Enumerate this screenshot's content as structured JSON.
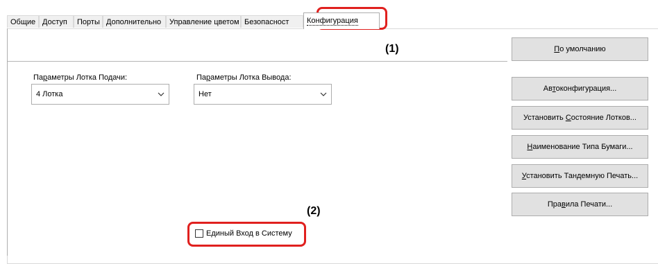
{
  "tabs": [
    {
      "label": "Общие"
    },
    {
      "label": "Доступ"
    },
    {
      "label": "Порты"
    },
    {
      "label": "Дополнительно"
    },
    {
      "label": "Управление цветом"
    },
    {
      "label": "Безопасност"
    },
    {
      "label": "Конфигурация"
    }
  ],
  "active_tab": "Конфигурация",
  "callouts": {
    "one": "(1)",
    "two": "(2)"
  },
  "defaults_button": {
    "pre": "",
    "ul": "П",
    "post": "о умолчанию"
  },
  "input_tray": {
    "label_pre": "Па",
    "label_ul": "р",
    "label_post": "аметры Лотка Подачи:",
    "value": "4 Лотка"
  },
  "output_tray": {
    "label_pre": "Па",
    "label_ul": "р",
    "label_post": "аметры Лотка Вывода:",
    "value": "Нет"
  },
  "right_buttons": [
    {
      "pre": "Ав",
      "ul": "т",
      "post": "оконфигурация..."
    },
    {
      "pre": "Установить ",
      "ul": "С",
      "post": "остояние Лотков..."
    },
    {
      "pre": "",
      "ul": "Н",
      "post": "аименование Типа Бумаги..."
    },
    {
      "pre": "",
      "ul": "У",
      "post": "становить Тандемную Печать..."
    },
    {
      "pre": "Пра",
      "ul": "в",
      "post": "ила Печати..."
    }
  ],
  "single_sign_on": {
    "label": "Единый Вход в Систему",
    "checked": false
  },
  "colors": {
    "callout": "#e0201e",
    "button_bg": "#e1e1e1"
  }
}
